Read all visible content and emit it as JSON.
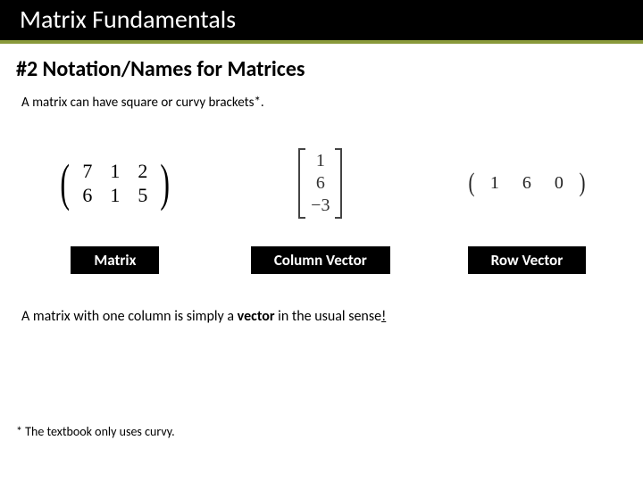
{
  "title": "Matrix Fundamentals",
  "subtitle": "#2 Notation/Names for Matrices",
  "intro": "A matrix can have square or curvy brackets*.",
  "matrix": {
    "rows": [
      [
        "7",
        "1",
        "2"
      ],
      [
        "6",
        "1",
        "5"
      ]
    ],
    "label": "Matrix"
  },
  "column_vector": {
    "values": [
      "1",
      "6",
      "−3"
    ],
    "label": "Column Vector"
  },
  "row_vector": {
    "values": [
      "1",
      "6",
      "0"
    ],
    "label": "Row Vector"
  },
  "statement_prefix": "A matrix with one column is simply a ",
  "statement_bold": "vector",
  "statement_suffix": " in the usual sense",
  "statement_excl": "!",
  "footnote": "* The textbook only uses curvy."
}
